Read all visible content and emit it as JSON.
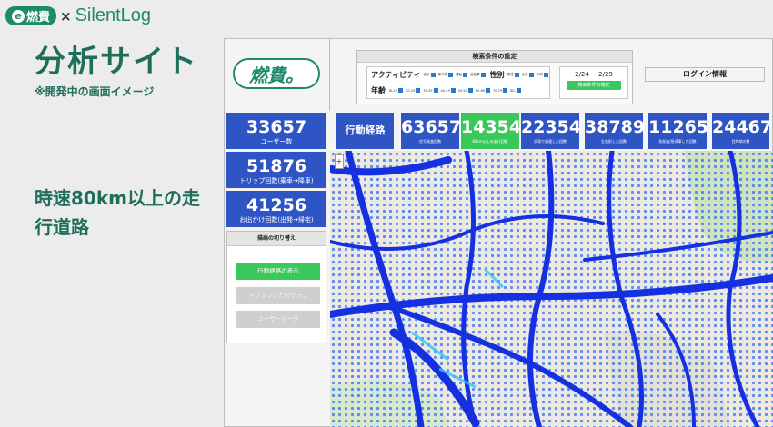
{
  "slide": {
    "brand_logo_text": "燃費",
    "brand_x": "×",
    "brand_partner": "SilentLog",
    "title": "分析サイト",
    "note": "※開発中の画面イメージ",
    "caption": "時速80km以上の走行道路"
  },
  "app": {
    "logo_text": "燃費。",
    "search": {
      "title": "検索条件の設定",
      "activity_label": "アクティビティ",
      "activity_options": [
        "徒歩",
        "乗り物",
        "運転",
        "自転車"
      ],
      "gender_label": "性別",
      "gender_options": [
        "男性",
        "女性",
        "不明"
      ],
      "age_label": "年齢",
      "age_options": [
        "18-19",
        "20-29",
        "30-39",
        "40-49",
        "50-59",
        "60-69",
        "70-79",
        "80-"
      ],
      "date_range": "2/24 ~ 2/29",
      "confirm_label": "検索条件の確定"
    },
    "login_label": "ログイン情報",
    "stats": [
      {
        "value": "33657",
        "label": "ユーザー数"
      },
      {
        "value": "51876",
        "label": "トリップ回数(乗車→降車)"
      },
      {
        "value": "41256",
        "label": "お出かけ回数(出発→帰宅)"
      }
    ],
    "switch_panel": {
      "title": "描画の切り替え",
      "buttons": [
        "行動経路の表示",
        "トリップごとのグラフ",
        "ユーザーデータ"
      ]
    },
    "metrics_label": "行動経路",
    "metrics": [
      {
        "value": "63657",
        "label": "信号発進回数"
      },
      {
        "value": "14354",
        "label": "80km以上の走行回数"
      },
      {
        "value": "22354",
        "label": "渋滞で減速した回数"
      },
      {
        "value": "38789",
        "label": "左右折した回数"
      },
      {
        "value": "11265",
        "label": "急発進/急停車した回数"
      },
      {
        "value": "24467",
        "label": "目的地の数"
      }
    ],
    "map_zoom": "+"
  },
  "colors": {
    "brand_green": "#1f8a6a",
    "stat_blue": "#2f55c5",
    "active_green": "#3bc85a",
    "route_blue": "#1430e0"
  }
}
